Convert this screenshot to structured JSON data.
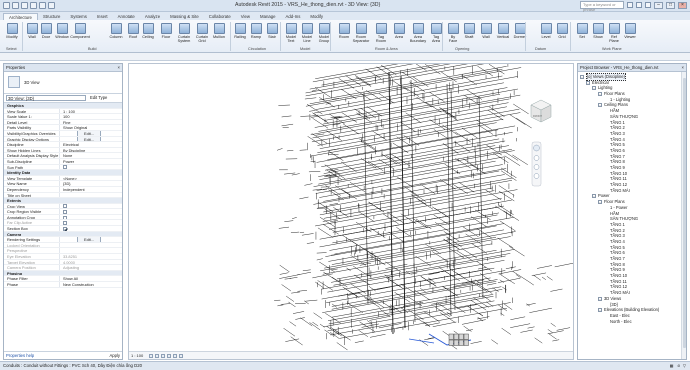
{
  "app": {
    "title": "Autodesk Revit 2015 -      VRS_He_thong_dien.rvt - 3D View: {3D}",
    "search_placeholder": "Type a keyword or phrase",
    "sign_in": "Sign In"
  },
  "ribbon_tabs": [
    "Architecture",
    "Structure",
    "Systems",
    "Insert",
    "Annotate",
    "Analyze",
    "Massing & Site",
    "Collaborate",
    "View",
    "Manage",
    "Add-Ins",
    "Modify"
  ],
  "ribbon": {
    "buttons": [
      "Modify",
      "Wall",
      "Door",
      "Window",
      "Component",
      "Column",
      "Roof",
      "Ceiling",
      "Floor",
      "Curtain System",
      "Curtain Grid",
      "Mullion",
      "Railing",
      "Ramp",
      "Stair",
      "Model Text",
      "Model Line",
      "Model Group",
      "Room",
      "Room Separator",
      "Tag Room",
      "Area",
      "Area Boundary",
      "Tag Area",
      "By Face",
      "Shaft",
      "Wall",
      "Vertical",
      "Dormer",
      "Level",
      "Grid",
      "Set",
      "Show",
      "Ref Plane",
      "Viewer"
    ],
    "groups": [
      "Select",
      "Build",
      "Circulation",
      "Model",
      "Room & Area",
      "Opening",
      "Datum",
      "Work Plane"
    ]
  },
  "properties": {
    "header": "Properties",
    "type_name": "3D View",
    "filter_value": "3D View: {3D}",
    "edit_type": "Edit Type",
    "rows": [
      {
        "k": "Graphics",
        "v": "",
        "g": true
      },
      {
        "k": "View Scale",
        "v": "1 : 100"
      },
      {
        "k": "Scale Value    1:",
        "v": "100"
      },
      {
        "k": "Detail Level",
        "v": "Fine"
      },
      {
        "k": "Parts Visibility",
        "v": "Show Original"
      },
      {
        "k": "Visibility/Graphics Overrides",
        "v": "Edit...",
        "b": true
      },
      {
        "k": "Graphic Display Options",
        "v": "Edit...",
        "b": true
      },
      {
        "k": "Discipline",
        "v": "Electrical"
      },
      {
        "k": "Show Hidden Lines",
        "v": "By Discipline"
      },
      {
        "k": "Default Analysis Display Style",
        "v": "None"
      },
      {
        "k": "Sub-Discipline",
        "v": "Power"
      },
      {
        "k": "Sun Path",
        "v": "",
        "c": false
      },
      {
        "k": "Identity Data",
        "v": "",
        "g": true
      },
      {
        "k": "View Template",
        "v": "<None>"
      },
      {
        "k": "View Name",
        "v": "{3D}"
      },
      {
        "k": "Dependency",
        "v": "Independent"
      },
      {
        "k": "Title on Sheet",
        "v": ""
      },
      {
        "k": "Extents",
        "v": "",
        "g": true
      },
      {
        "k": "Crop View",
        "v": "",
        "c": false
      },
      {
        "k": "Crop Region Visible",
        "v": "",
        "c": false
      },
      {
        "k": "Annotation Crop",
        "v": "",
        "c": false
      },
      {
        "k": "Far Clip Active",
        "v": "",
        "c": false,
        "d": true
      },
      {
        "k": "Section Box",
        "v": "",
        "c": true
      },
      {
        "k": "Camera",
        "v": "",
        "g": true
      },
      {
        "k": "Rendering Settings",
        "v": "Edit...",
        "b": true
      },
      {
        "k": "Locked Orientation",
        "v": "",
        "d": true
      },
      {
        "k": "Perspective",
        "v": "",
        "d": true
      },
      {
        "k": "Eye Elevation",
        "v": "33.8251",
        "d": true
      },
      {
        "k": "Target Elevation",
        "v": "4.0000",
        "d": true
      },
      {
        "k": "Camera Position",
        "v": "Adjusting",
        "d": true
      },
      {
        "k": "Phasing",
        "v": "",
        "g": true
      },
      {
        "k": "Phase Filter",
        "v": "Show All"
      },
      {
        "k": "Phase",
        "v": "New Construction"
      }
    ],
    "help": "Properties help",
    "apply": "Apply"
  },
  "view": {
    "scale": "1 : 100",
    "cube_label": "FRONT"
  },
  "browser": {
    "header": "Project Browser - VRS_He_thong_dien.rvt",
    "nodes": [
      {
        "t": "[o] Views (Discipline)",
        "l": 0,
        "tg": "-"
      },
      {
        "t": "Electrical",
        "l": 1,
        "tg": "-"
      },
      {
        "t": "Lighting",
        "l": 2,
        "tg": "-"
      },
      {
        "t": "Floor Plans",
        "l": 3,
        "tg": "-"
      },
      {
        "t": "1 - Lighting",
        "l": 4
      },
      {
        "t": "Ceiling Plans",
        "l": 3,
        "tg": "-"
      },
      {
        "t": "HẦM",
        "l": 4
      },
      {
        "t": "SÂN THƯỢNG",
        "l": 4
      },
      {
        "t": "TẦNG 1",
        "l": 4
      },
      {
        "t": "TẦNG 2",
        "l": 4
      },
      {
        "t": "TẦNG 3",
        "l": 4
      },
      {
        "t": "TẦNG 4",
        "l": 4
      },
      {
        "t": "TẦNG 5",
        "l": 4
      },
      {
        "t": "TẦNG 6",
        "l": 4
      },
      {
        "t": "TẦNG 7",
        "l": 4
      },
      {
        "t": "TẦNG 8",
        "l": 4
      },
      {
        "t": "TẦNG 9",
        "l": 4
      },
      {
        "t": "TẦNG 10",
        "l": 4
      },
      {
        "t": "TẦNG 11",
        "l": 4
      },
      {
        "t": "TẦNG 12",
        "l": 4
      },
      {
        "t": "TẦNG MÁI",
        "l": 4
      },
      {
        "t": "Power",
        "l": 2,
        "tg": "-"
      },
      {
        "t": "Floor Plans",
        "l": 3,
        "tg": "-"
      },
      {
        "t": "1 - Power",
        "l": 4
      },
      {
        "t": "HẦM",
        "l": 4
      },
      {
        "t": "SÂN THƯỢNG",
        "l": 4
      },
      {
        "t": "TẦNG 1",
        "l": 4
      },
      {
        "t": "TẦNG 2",
        "l": 4
      },
      {
        "t": "TẦNG 3",
        "l": 4
      },
      {
        "t": "TẦNG 4",
        "l": 4
      },
      {
        "t": "TẦNG 5",
        "l": 4
      },
      {
        "t": "TẦNG 6",
        "l": 4
      },
      {
        "t": "TẦNG 7",
        "l": 4
      },
      {
        "t": "TẦNG 8",
        "l": 4
      },
      {
        "t": "TẦNG 9",
        "l": 4
      },
      {
        "t": "TẦNG 10",
        "l": 4
      },
      {
        "t": "TẦNG 11",
        "l": 4
      },
      {
        "t": "TẦNG 12",
        "l": 4
      },
      {
        "t": "TẦNG MÁI",
        "l": 4
      },
      {
        "t": "3D Views",
        "l": 3,
        "tg": "-"
      },
      {
        "t": "{3D}",
        "l": 4
      },
      {
        "t": "Elevations (Building Elevation)",
        "l": 3,
        "tg": "-"
      },
      {
        "t": "East - Elec",
        "l": 4
      },
      {
        "t": "North - Elec",
        "l": 4
      }
    ]
  },
  "status": {
    "text": "Conduits : Conduit without Fittings : PVC Sch 40, Dây Điện chìa ống D20",
    "zoom": ":0"
  }
}
